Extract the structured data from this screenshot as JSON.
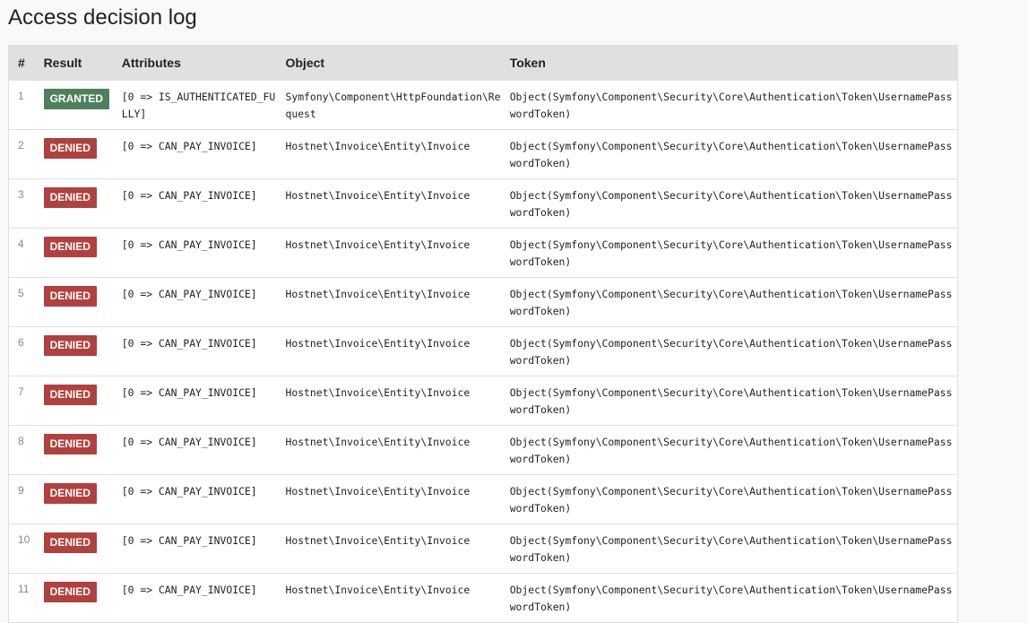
{
  "page": {
    "title": "Access decision log"
  },
  "table": {
    "headers": {
      "num": "#",
      "result": "Result",
      "attributes": "Attributes",
      "object": "Object",
      "token": "Token"
    },
    "rows": [
      {
        "num": "1",
        "result": "GRANTED",
        "status": "granted",
        "attributes": "[0 => IS_AUTHENTICATED_FULLY]",
        "object": "Symfony\\Component\\HttpFoundation\\Request",
        "token": "Object(Symfony\\Component\\Security\\Core\\Authentication\\Token\\UsernamePasswordToken)"
      },
      {
        "num": "2",
        "result": "DENIED",
        "status": "denied",
        "attributes": "[0 => CAN_PAY_INVOICE]",
        "object": "Hostnet\\Invoice\\Entity\\Invoice",
        "token": "Object(Symfony\\Component\\Security\\Core\\Authentication\\Token\\UsernamePasswordToken)"
      },
      {
        "num": "3",
        "result": "DENIED",
        "status": "denied",
        "attributes": "[0 => CAN_PAY_INVOICE]",
        "object": "Hostnet\\Invoice\\Entity\\Invoice",
        "token": "Object(Symfony\\Component\\Security\\Core\\Authentication\\Token\\UsernamePasswordToken)"
      },
      {
        "num": "4",
        "result": "DENIED",
        "status": "denied",
        "attributes": "[0 => CAN_PAY_INVOICE]",
        "object": "Hostnet\\Invoice\\Entity\\Invoice",
        "token": "Object(Symfony\\Component\\Security\\Core\\Authentication\\Token\\UsernamePasswordToken)"
      },
      {
        "num": "5",
        "result": "DENIED",
        "status": "denied",
        "attributes": "[0 => CAN_PAY_INVOICE]",
        "object": "Hostnet\\Invoice\\Entity\\Invoice",
        "token": "Object(Symfony\\Component\\Security\\Core\\Authentication\\Token\\UsernamePasswordToken)"
      },
      {
        "num": "6",
        "result": "DENIED",
        "status": "denied",
        "attributes": "[0 => CAN_PAY_INVOICE]",
        "object": "Hostnet\\Invoice\\Entity\\Invoice",
        "token": "Object(Symfony\\Component\\Security\\Core\\Authentication\\Token\\UsernamePasswordToken)"
      },
      {
        "num": "7",
        "result": "DENIED",
        "status": "denied",
        "attributes": "[0 => CAN_PAY_INVOICE]",
        "object": "Hostnet\\Invoice\\Entity\\Invoice",
        "token": "Object(Symfony\\Component\\Security\\Core\\Authentication\\Token\\UsernamePasswordToken)"
      },
      {
        "num": "8",
        "result": "DENIED",
        "status": "denied",
        "attributes": "[0 => CAN_PAY_INVOICE]",
        "object": "Hostnet\\Invoice\\Entity\\Invoice",
        "token": "Object(Symfony\\Component\\Security\\Core\\Authentication\\Token\\UsernamePasswordToken)"
      },
      {
        "num": "9",
        "result": "DENIED",
        "status": "denied",
        "attributes": "[0 => CAN_PAY_INVOICE]",
        "object": "Hostnet\\Invoice\\Entity\\Invoice",
        "token": "Object(Symfony\\Component\\Security\\Core\\Authentication\\Token\\UsernamePasswordToken)"
      },
      {
        "num": "10",
        "result": "DENIED",
        "status": "denied",
        "attributes": "[0 => CAN_PAY_INVOICE]",
        "object": "Hostnet\\Invoice\\Entity\\Invoice",
        "token": "Object(Symfony\\Component\\Security\\Core\\Authentication\\Token\\UsernamePasswordToken)"
      },
      {
        "num": "11",
        "result": "DENIED",
        "status": "denied",
        "attributes": "[0 => CAN_PAY_INVOICE]",
        "object": "Hostnet\\Invoice\\Entity\\Invoice",
        "token": "Object(Symfony\\Component\\Security\\Core\\Authentication\\Token\\UsernamePasswordToken)"
      }
    ]
  }
}
